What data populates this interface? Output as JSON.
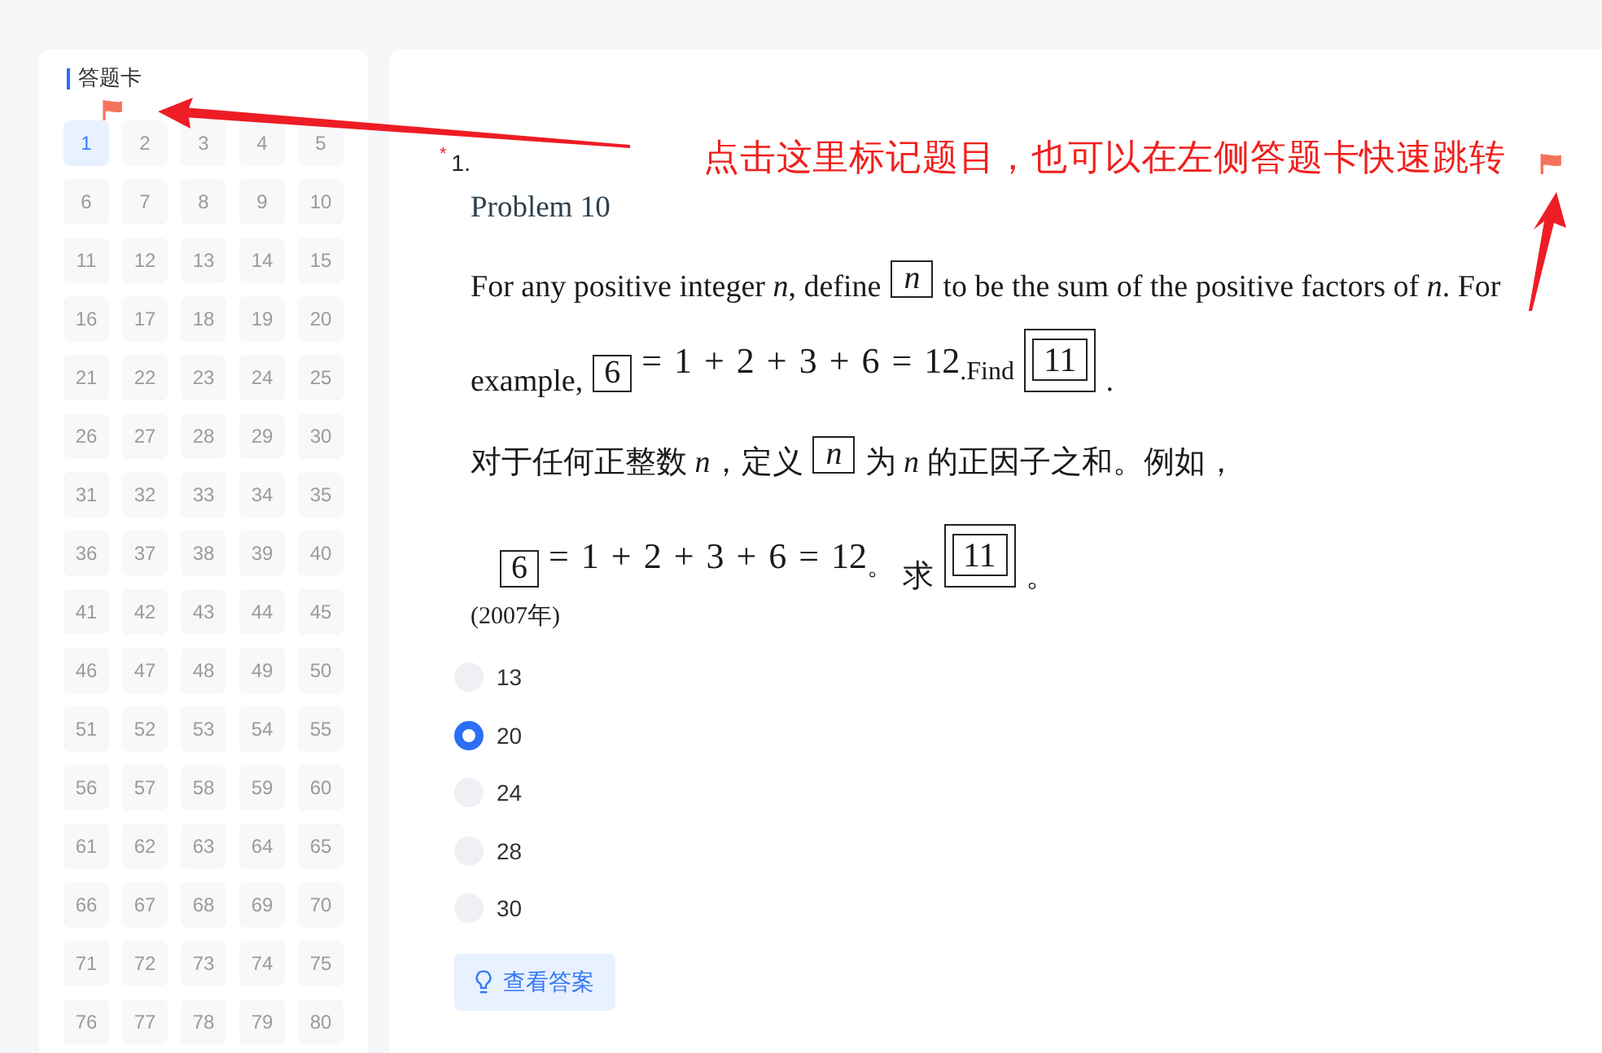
{
  "answer_card": {
    "title": "答题卡",
    "items": [
      {
        "label": "1",
        "selected": true,
        "flagged": true
      },
      {
        "label": "2",
        "selected": false,
        "flagged": false
      },
      {
        "label": "3",
        "selected": false,
        "flagged": false
      },
      {
        "label": "4",
        "selected": false,
        "flagged": false
      },
      {
        "label": "5",
        "selected": false,
        "flagged": false
      },
      {
        "label": "6",
        "selected": false,
        "flagged": false
      },
      {
        "label": "7",
        "selected": false,
        "flagged": false
      },
      {
        "label": "8",
        "selected": false,
        "flagged": false
      },
      {
        "label": "9",
        "selected": false,
        "flagged": false
      },
      {
        "label": "10",
        "selected": false,
        "flagged": false
      },
      {
        "label": "11",
        "selected": false,
        "flagged": false
      },
      {
        "label": "12",
        "selected": false,
        "flagged": false
      },
      {
        "label": "13",
        "selected": false,
        "flagged": false
      },
      {
        "label": "14",
        "selected": false,
        "flagged": false
      },
      {
        "label": "15",
        "selected": false,
        "flagged": false
      },
      {
        "label": "16",
        "selected": false,
        "flagged": false
      },
      {
        "label": "17",
        "selected": false,
        "flagged": false
      },
      {
        "label": "18",
        "selected": false,
        "flagged": false
      },
      {
        "label": "19",
        "selected": false,
        "flagged": false
      },
      {
        "label": "20",
        "selected": false,
        "flagged": false
      },
      {
        "label": "21",
        "selected": false,
        "flagged": false
      },
      {
        "label": "22",
        "selected": false,
        "flagged": false
      },
      {
        "label": "23",
        "selected": false,
        "flagged": false
      },
      {
        "label": "24",
        "selected": false,
        "flagged": false
      },
      {
        "label": "25",
        "selected": false,
        "flagged": false
      },
      {
        "label": "26",
        "selected": false,
        "flagged": false
      },
      {
        "label": "27",
        "selected": false,
        "flagged": false
      },
      {
        "label": "28",
        "selected": false,
        "flagged": false
      },
      {
        "label": "29",
        "selected": false,
        "flagged": false
      },
      {
        "label": "30",
        "selected": false,
        "flagged": false
      },
      {
        "label": "31",
        "selected": false,
        "flagged": false
      },
      {
        "label": "32",
        "selected": false,
        "flagged": false
      },
      {
        "label": "33",
        "selected": false,
        "flagged": false
      },
      {
        "label": "34",
        "selected": false,
        "flagged": false
      },
      {
        "label": "35",
        "selected": false,
        "flagged": false
      },
      {
        "label": "36",
        "selected": false,
        "flagged": false
      },
      {
        "label": "37",
        "selected": false,
        "flagged": false
      },
      {
        "label": "38",
        "selected": false,
        "flagged": false
      },
      {
        "label": "39",
        "selected": false,
        "flagged": false
      },
      {
        "label": "40",
        "selected": false,
        "flagged": false
      },
      {
        "label": "41",
        "selected": false,
        "flagged": false
      },
      {
        "label": "42",
        "selected": false,
        "flagged": false
      },
      {
        "label": "43",
        "selected": false,
        "flagged": false
      },
      {
        "label": "44",
        "selected": false,
        "flagged": false
      },
      {
        "label": "45",
        "selected": false,
        "flagged": false
      },
      {
        "label": "46",
        "selected": false,
        "flagged": false
      },
      {
        "label": "47",
        "selected": false,
        "flagged": false
      },
      {
        "label": "48",
        "selected": false,
        "flagged": false
      },
      {
        "label": "49",
        "selected": false,
        "flagged": false
      },
      {
        "label": "50",
        "selected": false,
        "flagged": false
      },
      {
        "label": "51",
        "selected": false,
        "flagged": false
      },
      {
        "label": "52",
        "selected": false,
        "flagged": false
      },
      {
        "label": "53",
        "selected": false,
        "flagged": false
      },
      {
        "label": "54",
        "selected": false,
        "flagged": false
      },
      {
        "label": "55",
        "selected": false,
        "flagged": false
      },
      {
        "label": "56",
        "selected": false,
        "flagged": false
      },
      {
        "label": "57",
        "selected": false,
        "flagged": false
      },
      {
        "label": "58",
        "selected": false,
        "flagged": false
      },
      {
        "label": "59",
        "selected": false,
        "flagged": false
      },
      {
        "label": "60",
        "selected": false,
        "flagged": false
      },
      {
        "label": "61",
        "selected": false,
        "flagged": false
      },
      {
        "label": "62",
        "selected": false,
        "flagged": false
      },
      {
        "label": "63",
        "selected": false,
        "flagged": false
      },
      {
        "label": "64",
        "selected": false,
        "flagged": false
      },
      {
        "label": "65",
        "selected": false,
        "flagged": false
      },
      {
        "label": "66",
        "selected": false,
        "flagged": false
      },
      {
        "label": "67",
        "selected": false,
        "flagged": false
      },
      {
        "label": "68",
        "selected": false,
        "flagged": false
      },
      {
        "label": "69",
        "selected": false,
        "flagged": false
      },
      {
        "label": "70",
        "selected": false,
        "flagged": false
      },
      {
        "label": "71",
        "selected": false,
        "flagged": false
      },
      {
        "label": "72",
        "selected": false,
        "flagged": false
      },
      {
        "label": "73",
        "selected": false,
        "flagged": false
      },
      {
        "label": "74",
        "selected": false,
        "flagged": false
      },
      {
        "label": "75",
        "selected": false,
        "flagged": false
      },
      {
        "label": "76",
        "selected": false,
        "flagged": false
      },
      {
        "label": "77",
        "selected": false,
        "flagged": false
      },
      {
        "label": "78",
        "selected": false,
        "flagged": false
      },
      {
        "label": "79",
        "selected": false,
        "flagged": false
      },
      {
        "label": "80",
        "selected": false,
        "flagged": false
      }
    ]
  },
  "question": {
    "required_mark": "*",
    "number": "1.",
    "flagged": true,
    "title": "Problem 10",
    "statement": [
      {
        "kind": "text",
        "segments": [
          {
            "kind": "text",
            "text": "For any positive integer *n*, define"
          },
          {
            "kind": "box",
            "text": "n",
            "italic": true
          },
          {
            "kind": "text",
            "text": "to be the sum of the positive factors of *n*. For"
          }
        ]
      },
      {
        "kind": "text",
        "segments": [
          {
            "kind": "text",
            "text": "example,"
          },
          {
            "kind": "box",
            "text": "6",
            "italic": false
          },
          {
            "kind": "math",
            "text": "= 1 + 2 + 3 + 6 = 12$_{.Find}$"
          },
          {
            "kind": "double_box",
            "text": "11"
          },
          {
            "kind": "text",
            "text": "."
          }
        ]
      },
      {
        "kind": "text",
        "segments": [
          {
            "kind": "text",
            "text": "对于任何正整数 *n*，定义"
          },
          {
            "kind": "box",
            "text": "n",
            "italic": true
          },
          {
            "kind": "text",
            "text": "为 *n* 的正因子之和。例如，"
          }
        ]
      },
      {
        "kind": "display",
        "segments": [
          {
            "kind": "box",
            "text": "6",
            "italic": false
          },
          {
            "kind": "math",
            "text": "= 1 + 2 + 3 + 6 = 12$_{。}$"
          },
          {
            "kind": "text",
            "text": "求"
          },
          {
            "kind": "double_box",
            "text": "11"
          },
          {
            "kind": "text",
            "text": "。"
          }
        ]
      }
    ],
    "year": "(2007年)",
    "options": [
      {
        "label": "13",
        "selected": false
      },
      {
        "label": "20",
        "selected": true
      },
      {
        "label": "24",
        "selected": false
      },
      {
        "label": "28",
        "selected": false
      },
      {
        "label": "30",
        "selected": false
      }
    ],
    "answer_button": "查看答案"
  },
  "annotation": {
    "text": "点击这里标记题目，也可以在左侧答题卡快速跳转"
  }
}
